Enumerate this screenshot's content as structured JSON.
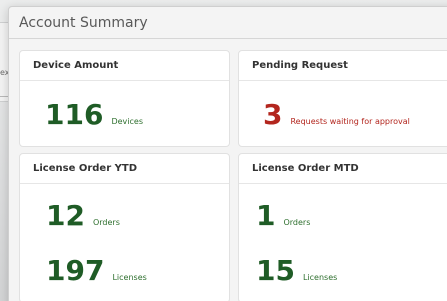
{
  "window": {
    "title": "Account Summary"
  },
  "background": {
    "edge_text": "ex"
  },
  "cards": {
    "device_amount": {
      "title": "Device Amount",
      "value": "116",
      "unit": "Devices"
    },
    "pending_request": {
      "title": "Pending Request",
      "value": "3",
      "unit": "Requests waiting for approval"
    },
    "license_order_ytd": {
      "title": "License Order YTD",
      "orders_value": "12",
      "orders_unit": "Orders",
      "licenses_value": "197",
      "licenses_unit": "Licenses"
    },
    "license_order_mtd": {
      "title": "License Order MTD",
      "orders_value": "1",
      "orders_unit": "Orders",
      "licenses_value": "15",
      "licenses_unit": "Licenses"
    }
  },
  "colors": {
    "value_green": "#1f5c26",
    "unit_green": "#2e6f2e",
    "warning_red": "#b3261e"
  }
}
